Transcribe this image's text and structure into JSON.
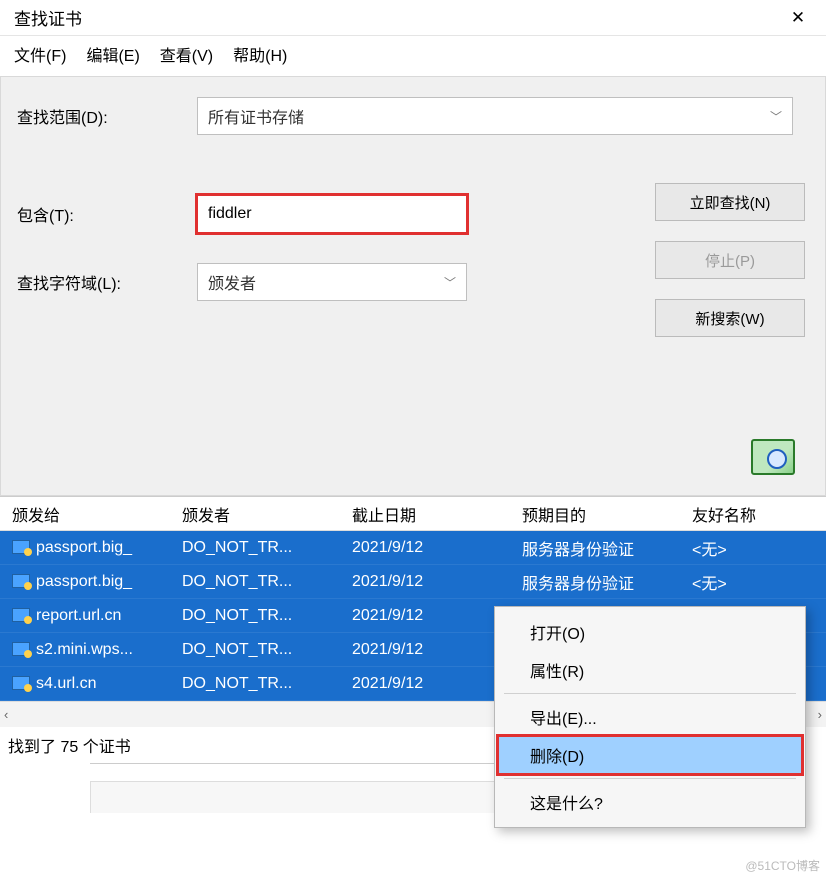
{
  "window": {
    "title": "查找证书",
    "close_glyph": "✕"
  },
  "menubar": {
    "file": "文件(F)",
    "edit": "编辑(E)",
    "view": "查看(V)",
    "help": "帮助(H)"
  },
  "form": {
    "scope_label": "查找范围(D):",
    "scope_value": "所有证书存储",
    "contains_label": "包含(T):",
    "contains_value": "fiddler",
    "field_label": "查找字符域(L):",
    "field_value": "颁发者"
  },
  "buttons": {
    "find_now": "立即查找(N)",
    "stop": "停止(P)",
    "new_search": "新搜索(W)"
  },
  "columns": {
    "issued_to": "颁发给",
    "issued_by": "颁发者",
    "expires": "截止日期",
    "purpose": "预期目的",
    "friendly_name": "友好名称"
  },
  "rows": [
    {
      "issued_to": "passport.big_",
      "issued_by": "DO_NOT_TR...",
      "expires": "2021/9/12",
      "purpose": "服务器身份验证",
      "friendly": "<无>"
    },
    {
      "issued_to": "passport.big_",
      "issued_by": "DO_NOT_TR...",
      "expires": "2021/9/12",
      "purpose": "服务器身份验证",
      "friendly": "<无>"
    },
    {
      "issued_to": "report.url.cn",
      "issued_by": "DO_NOT_TR...",
      "expires": "2021/9/12",
      "purpose": "",
      "friendly": ""
    },
    {
      "issued_to": "s2.mini.wps...",
      "issued_by": "DO_NOT_TR...",
      "expires": "2021/9/12",
      "purpose": "",
      "friendly": ""
    },
    {
      "issued_to": "s4.url.cn",
      "issued_by": "DO_NOT_TR...",
      "expires": "2021/9/12",
      "purpose": "",
      "friendly": ""
    }
  ],
  "status": "找到了 75 个证书",
  "context_menu": {
    "open": "打开(O)",
    "properties": "属性(R)",
    "export": "导出(E)...",
    "delete": "删除(D)",
    "whats_this": "这是什么?"
  },
  "watermark": "@51CTO博客"
}
